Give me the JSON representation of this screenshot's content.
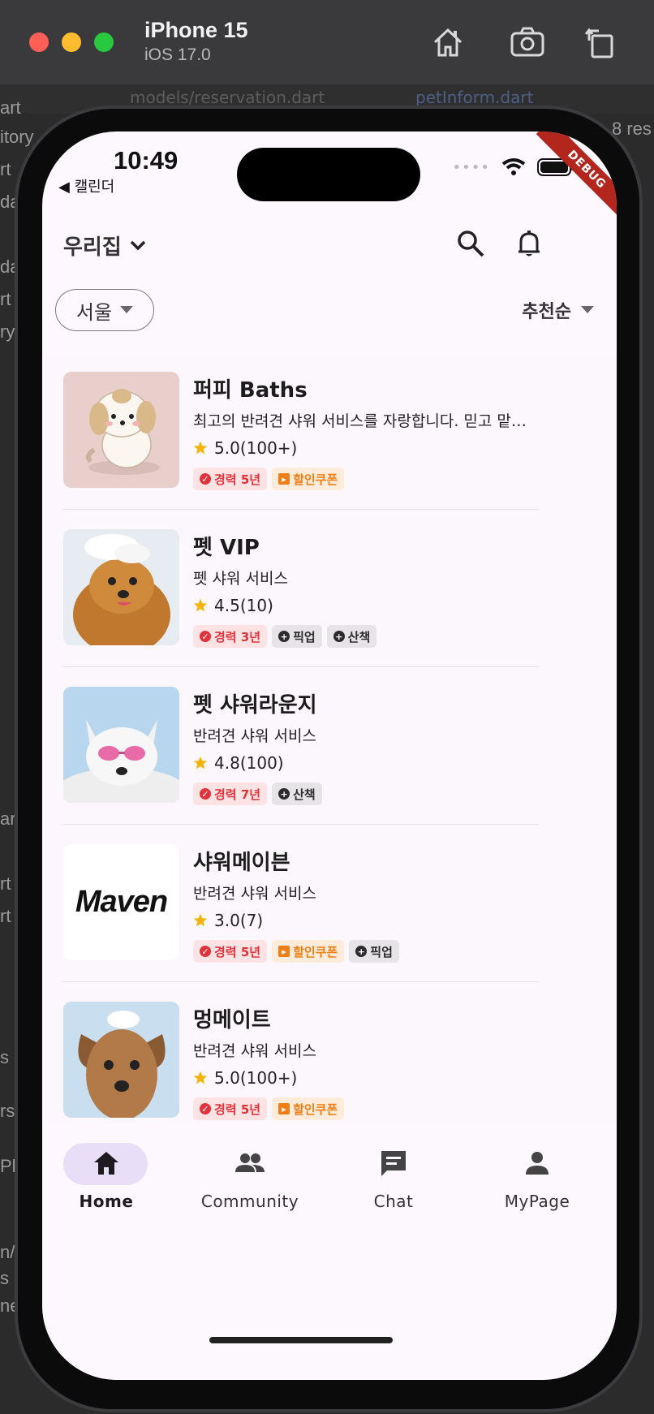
{
  "simulator": {
    "device": "iPhone 15",
    "os": "iOS 17.0"
  },
  "ide_bg": {
    "tab1": "models/reservation.dart",
    "tab2": "petInform.dart",
    "right_text": "8 res",
    "left_frags": [
      "art",
      "itory",
      "rt",
      "da",
      "da",
      "rt",
      "ry",
      "art",
      "rt",
      "rt",
      "s",
      "rs",
      "Ph",
      "n/",
      "s :",
      "ne"
    ]
  },
  "status": {
    "time": "10:49",
    "back_app": "◀ 캘린더",
    "debug": "DEBUG"
  },
  "header": {
    "location": "우리집"
  },
  "filters": {
    "region": "서울",
    "sort": "추천순"
  },
  "shops": [
    {
      "name": "퍼피 Baths",
      "desc": "최고의 반려견 샤워 서비스를 자랑합니다. 믿고 맡겨주세요",
      "rating": "5.0",
      "reviews": "(100+)",
      "tags": [
        {
          "type": "exp",
          "label": "경력 5년"
        },
        {
          "type": "coupon",
          "label": "할인쿠폰"
        }
      ],
      "thumb": "puppy-cartoon"
    },
    {
      "name": "펫 VIP",
      "desc": "펫 샤워 서비스",
      "rating": "4.5",
      "reviews": "(10)",
      "tags": [
        {
          "type": "exp",
          "label": "경력 3년"
        },
        {
          "type": "svc",
          "label": "픽업"
        },
        {
          "type": "svc",
          "label": "산책"
        }
      ],
      "thumb": "pomeranian-bath"
    },
    {
      "name": "펫 샤워라운지",
      "desc": "반려견 샤워 서비스",
      "rating": "4.8",
      "reviews": "(100)",
      "tags": [
        {
          "type": "exp",
          "label": "경력 7년"
        },
        {
          "type": "svc",
          "label": "산책"
        }
      ],
      "thumb": "white-dog-glasses"
    },
    {
      "name": "샤워메이븐",
      "desc": "반려견 샤워 서비스",
      "rating": "3.0",
      "reviews": "(7)",
      "tags": [
        {
          "type": "exp",
          "label": "경력 5년"
        },
        {
          "type": "coupon",
          "label": "할인쿠폰"
        },
        {
          "type": "svc",
          "label": "픽업"
        }
      ],
      "thumb": "maven-logo",
      "logo_text": "Maven"
    },
    {
      "name": "멍메이트",
      "desc": "반려견 샤워 서비스",
      "rating": "5.0",
      "reviews": "(100+)",
      "tags": [
        {
          "type": "exp",
          "label": "경력 5년"
        },
        {
          "type": "coupon",
          "label": "할인쿠폰"
        }
      ],
      "thumb": "terrier-bath"
    }
  ],
  "nav": [
    {
      "label": "Home",
      "icon": "home-icon",
      "active": true
    },
    {
      "label": "Community",
      "icon": "people-icon",
      "active": false
    },
    {
      "label": "Chat",
      "icon": "chat-icon",
      "active": false
    },
    {
      "label": "MyPage",
      "icon": "person-icon",
      "active": false
    }
  ],
  "colors": {
    "accent_pill": "#e8def8",
    "exp_tag": "#e0343c",
    "coupon_tag": "#ef7e16",
    "star": "#f5b301"
  }
}
